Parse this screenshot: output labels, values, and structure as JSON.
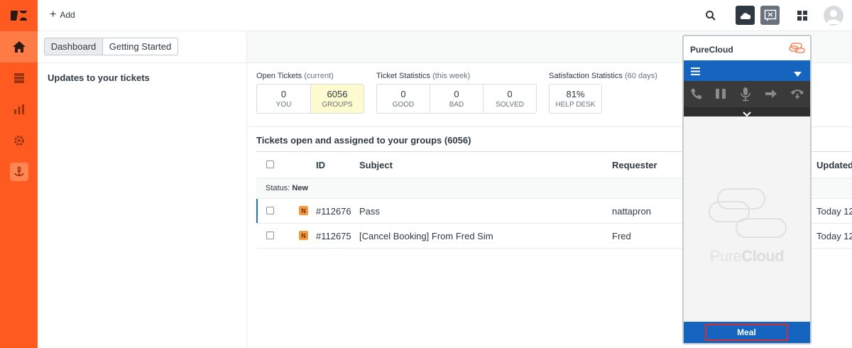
{
  "topbar": {
    "add_label": "Add"
  },
  "tabs": [
    {
      "label": "Dashboard"
    },
    {
      "label": "Getting Started"
    }
  ],
  "left_panel": {
    "title": "Updates to your tickets"
  },
  "stats": {
    "open": {
      "title": "Open Tickets",
      "sub": "(current)",
      "cells": [
        {
          "value": "0",
          "label": "YOU"
        },
        {
          "value": "6056",
          "label": "GROUPS"
        }
      ]
    },
    "ticket": {
      "title": "Ticket Statistics",
      "sub": "(this week)",
      "cells": [
        {
          "value": "0",
          "label": "GOOD"
        },
        {
          "value": "0",
          "label": "BAD"
        },
        {
          "value": "0",
          "label": "SOLVED"
        }
      ]
    },
    "satisfaction": {
      "title": "Satisfaction Statistics",
      "sub": "(60 days)",
      "cells": [
        {
          "value": "81%",
          "label": "HELP DESK"
        }
      ]
    }
  },
  "tickets": {
    "title": "Tickets open and assigned to your groups (6056)",
    "headers": {
      "id": "ID",
      "subject": "Subject",
      "requester": "Requester",
      "updated": "Updated"
    },
    "status_label": "Status:",
    "status_value": "New",
    "rows": [
      {
        "badge": "N",
        "id": "#112676",
        "subject": "Pass",
        "requester": "nattapron",
        "updated": "Today 12"
      },
      {
        "badge": "N",
        "id": "#112675",
        "subject": "[Cancel Booking] From Fred Sim",
        "requester": "Fred",
        "updated": "Today 12"
      }
    ]
  },
  "purecloud": {
    "title": "PureCloud",
    "brand_light": "Pure",
    "brand_bold": "Cloud",
    "meal_label": "Meal",
    "accent": "#1565c0"
  },
  "colors": {
    "sidebar": "#ff5a1f",
    "highlight": "#fefbd1",
    "badge": "#f79a3e"
  }
}
